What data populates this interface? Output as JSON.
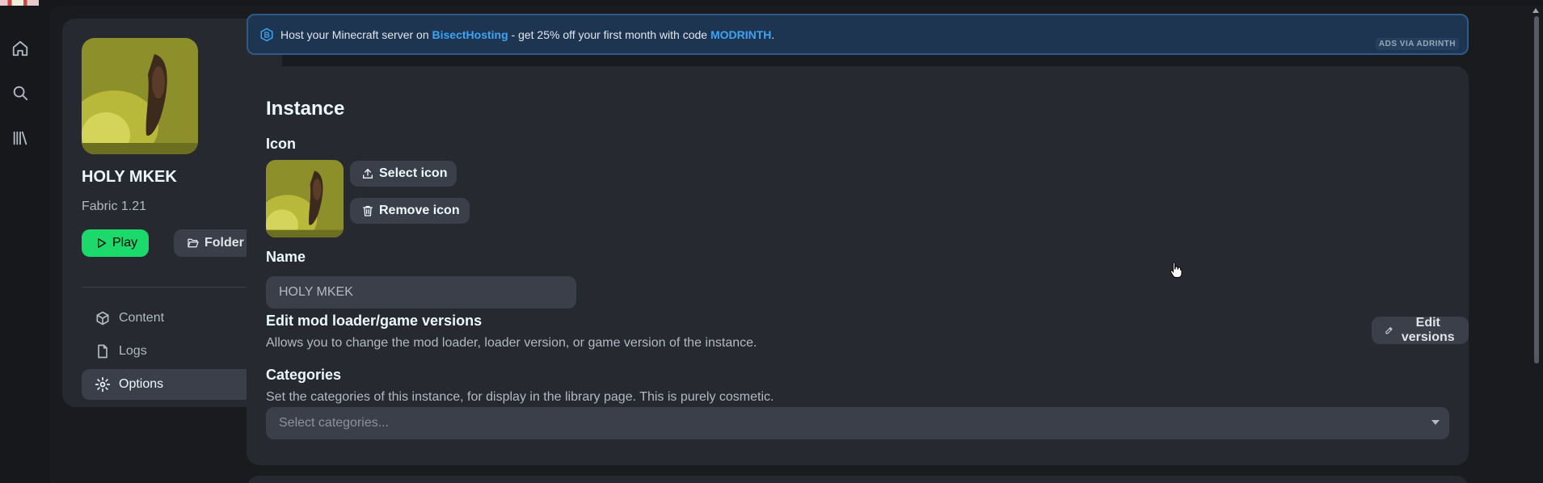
{
  "nav_rail": {
    "items": [
      "home-icon",
      "search-icon",
      "library-icon"
    ]
  },
  "sidebar": {
    "instance_name": "HOLY MKEK",
    "instance_version": "Fabric 1.21",
    "play_label": "Play",
    "folder_label": "Folder",
    "nav": [
      {
        "label": "Content",
        "icon": "box-icon",
        "active": false
      },
      {
        "label": "Logs",
        "icon": "file-icon",
        "active": false
      },
      {
        "label": "Options",
        "icon": "gear-icon",
        "active": true
      }
    ]
  },
  "ad": {
    "text_before": "Host your Minecraft server on ",
    "brand": "BisectHosting",
    "text_middle": " - get 25% off your first month with code ",
    "code": "MODRINTH",
    "text_after": ".",
    "tag": "ADS VIA ADRINTH"
  },
  "settings": {
    "title": "Instance",
    "icon_label": "Icon",
    "select_icon_label": "Select icon",
    "remove_icon_label": "Remove icon",
    "name_label": "Name",
    "name_value": "HOLY MKEK",
    "versions_label": "Edit mod loader/game versions",
    "versions_desc": "Allows you to change the mod loader, loader version, or game version of the instance.",
    "edit_versions_label": "Edit versions",
    "categories_label": "Categories",
    "categories_desc": "Set the categories of this instance, for display in the library page. This is purely cosmetic.",
    "categories_placeholder": "Select categories..."
  },
  "colors": {
    "accent_green": "#1bd96a",
    "ad_blue": "#3ba4f5",
    "card_bg": "#26292f",
    "button_bg": "#3a3f4a"
  }
}
